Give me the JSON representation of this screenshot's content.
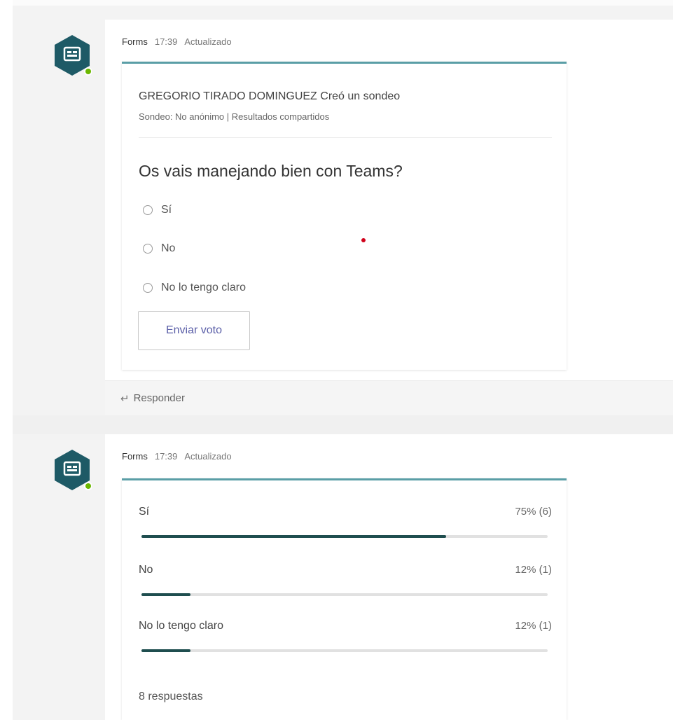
{
  "messages": [
    {
      "sender": "Forms",
      "time": "17:39",
      "status": "Actualizado",
      "poll": {
        "creator": "GREGORIO TIRADO DOMINGUEZ Creó un sondeo",
        "info": "Sondeo: No anónimo | Resultados compartidos",
        "question": "Os vais manejando bien con Teams?",
        "options": [
          "Sí",
          "No",
          "No lo tengo claro"
        ],
        "vote_button": "Enviar voto"
      },
      "reply_label": "Responder"
    },
    {
      "sender": "Forms",
      "time": "17:39",
      "status": "Actualizado",
      "results": [
        {
          "label": "Sí",
          "value_text": "75% (6)",
          "percent": 75
        },
        {
          "label": "No",
          "value_text": "12% (1)",
          "percent": 12
        },
        {
          "label": "No lo tengo claro",
          "value_text": "12% (1)",
          "percent": 12
        }
      ],
      "responses": "8 respuestas"
    }
  ],
  "colors": {
    "accent_border": "#5a9ea6",
    "bar_fill": "#1f4e4f",
    "avatar_bg": "#1e5a66",
    "presence": "#6bb700",
    "button_text": "#5b5fa8"
  },
  "icons": {
    "avatar": "forms-app-icon",
    "presence": "presence-available-icon",
    "reply": "reply-arrow-icon"
  }
}
